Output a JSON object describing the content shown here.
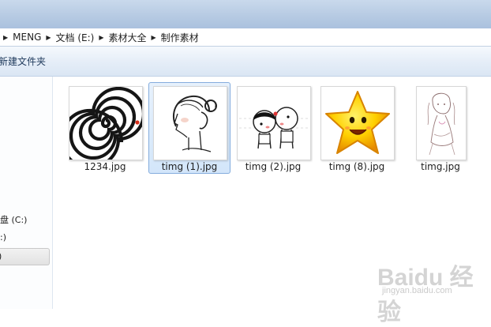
{
  "address_bar": {
    "crumbs": [
      "MENG",
      "文档 (E:)",
      "素材大全",
      "制作素材"
    ]
  },
  "toolbar": {
    "new_folder_label": "新建文件夹"
  },
  "sidebar": {
    "drives": [
      "盘 (C:)",
      ":)",
      ")"
    ]
  },
  "files": [
    {
      "name": "1234.jpg",
      "selected": false,
      "thumb_icon": "spiral-icon"
    },
    {
      "name": "timg (1).jpg",
      "selected": true,
      "thumb_icon": "girl-sketch-icon"
    },
    {
      "name": "timg (2).jpg",
      "selected": false,
      "thumb_icon": "cartoon-kiss-icon"
    },
    {
      "name": "timg (8).jpg",
      "selected": false,
      "thumb_icon": "smiley-star-icon"
    },
    {
      "name": "timg.jpg",
      "selected": false,
      "thumb_icon": "anime-girl-icon"
    }
  ],
  "watermark": {
    "logo_text": "Baidu 经验",
    "url_text": "jingyan.baidu.com"
  },
  "colors": {
    "selection_fill": "#d3e6fa",
    "selection_border": "#84acdd",
    "toolbar_text": "#1e395b"
  }
}
